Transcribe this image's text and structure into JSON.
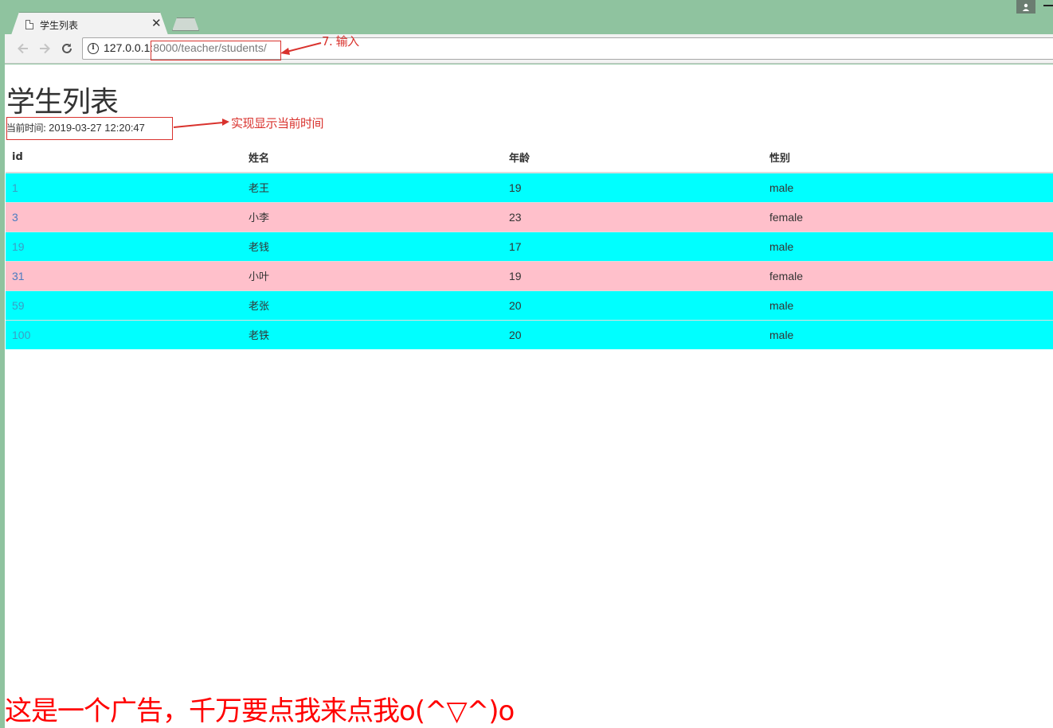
{
  "browser": {
    "tab": {
      "title": "学生列表",
      "close_glyph": "✕"
    },
    "address_bar": {
      "host": "127.0.0.1",
      "rest": ":8000/teacher/students/"
    }
  },
  "page": {
    "heading": "学生列表",
    "current_time_label": "当前时间:",
    "current_time_value": "2019-03-27 12:20:47",
    "table": {
      "columns": [
        "id",
        "姓名",
        "年龄",
        "性别"
      ],
      "rows": [
        {
          "id": "1",
          "name": "老王",
          "age": "19",
          "gender": "male",
          "color": "#00ffff"
        },
        {
          "id": "3",
          "name": "小李",
          "age": "23",
          "gender": "female",
          "color": "#ffc0cb"
        },
        {
          "id": "19",
          "name": "老钱",
          "age": "17",
          "gender": "male",
          "color": "#00ffff"
        },
        {
          "id": "31",
          "name": "小叶",
          "age": "19",
          "gender": "female",
          "color": "#ffc0cb"
        },
        {
          "id": "59",
          "name": "老张",
          "age": "20",
          "gender": "male",
          "color": "#00ffff"
        },
        {
          "id": "100",
          "name": "老铁",
          "age": "20",
          "gender": "male",
          "color": "#00ffff"
        }
      ]
    },
    "ad_text": "这是一个广告，千万要点我来点我o(^▽^)o"
  },
  "annotations": {
    "url_note": "7. 输入",
    "time_note": "实现显示当前时间",
    "color": "#d9322d"
  },
  "icons": [
    "page-icon",
    "close-icon",
    "profile-icon",
    "minimize-icon",
    "back-arrow-icon",
    "forward-arrow-icon",
    "reload-icon",
    "info-icon"
  ]
}
